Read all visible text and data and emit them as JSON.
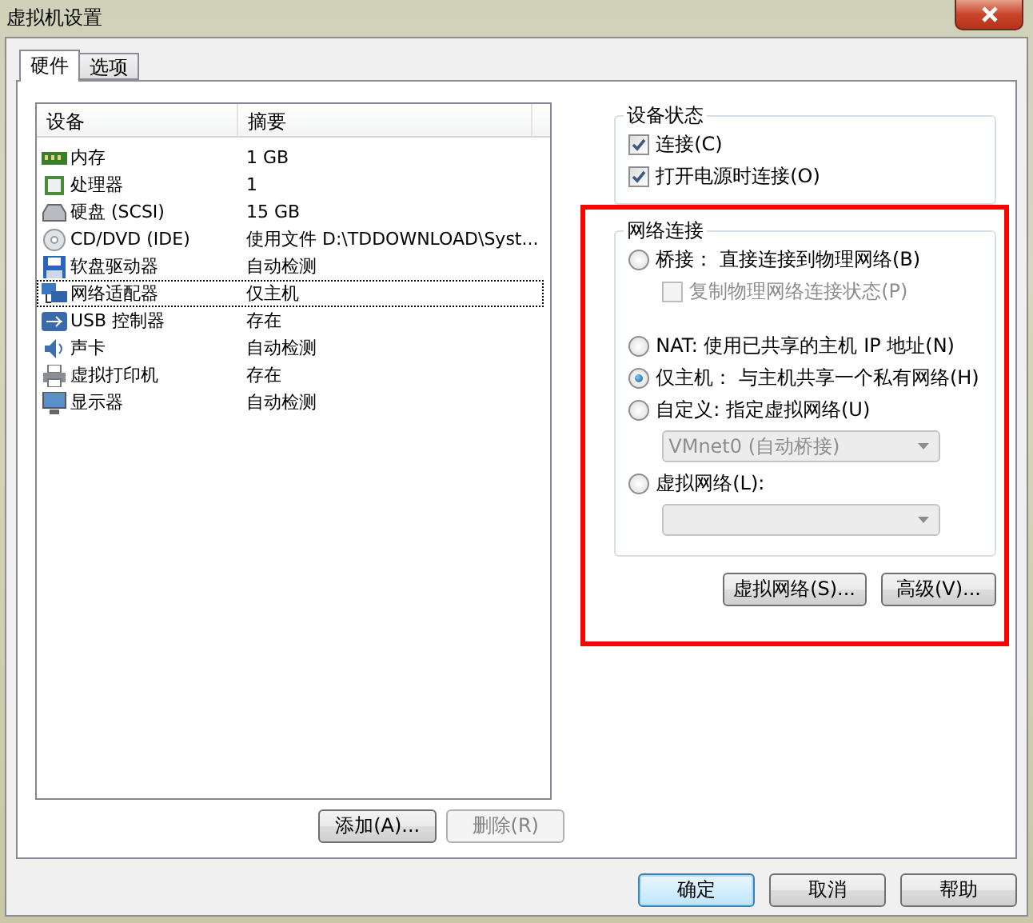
{
  "window": {
    "title": "虚拟机设置"
  },
  "tabs": [
    {
      "label": "硬件",
      "selected": true
    },
    {
      "label": "选项",
      "selected": false
    }
  ],
  "device_list": {
    "columns": [
      "设备",
      "摘要"
    ],
    "rows": [
      {
        "device": "内存",
        "summary": "1 GB",
        "selected": false
      },
      {
        "device": "处理器",
        "summary": "1",
        "selected": false
      },
      {
        "device": "硬盘 (SCSI)",
        "summary": "15 GB",
        "selected": false
      },
      {
        "device": "CD/DVD (IDE)",
        "summary": "使用文件 D:\\TDDOWNLOAD\\Syst...",
        "selected": false
      },
      {
        "device": "软盘驱动器",
        "summary": "自动检测",
        "selected": false
      },
      {
        "device": "网络适配器",
        "summary": "仅主机",
        "selected": true
      },
      {
        "device": "USB 控制器",
        "summary": "存在",
        "selected": false
      },
      {
        "device": "声卡",
        "summary": "自动检测",
        "selected": false
      },
      {
        "device": "虚拟打印机",
        "summary": "存在",
        "selected": false
      },
      {
        "device": "显示器",
        "summary": "自动检测",
        "selected": false
      }
    ]
  },
  "list_buttons": [
    {
      "label": "添加(A)...",
      "disabled": false
    },
    {
      "label": "删除(R)",
      "disabled": true
    }
  ],
  "device_status": {
    "title": "设备状态",
    "items": [
      {
        "label": "连接(C)",
        "checked": true
      },
      {
        "label": "打开电源时连接(O)",
        "checked": true
      }
    ]
  },
  "network_connection": {
    "title": "网络连接",
    "items": [
      {
        "kind": "radio",
        "label": "桥接： 直接连接到物理网络(B)",
        "selected": false
      },
      {
        "kind": "checkbox",
        "label": "复制物理网络连接状态(P)",
        "checked": false,
        "disabled": true
      },
      {
        "kind": "radio",
        "label": "NAT: 使用已共享的主机 IP 地址(N)",
        "selected": false
      },
      {
        "kind": "radio",
        "label": "仅主机： 与主机共享一个私有网络(H)",
        "selected": true
      },
      {
        "kind": "radio",
        "label": "自定义: 指定虚拟网络(U)",
        "selected": false
      },
      {
        "kind": "dropdown",
        "value": "VMnet0 (自动桥接)",
        "disabled": true
      },
      {
        "kind": "radio",
        "label": "虚拟网络(L):",
        "selected": false
      },
      {
        "kind": "dropdown",
        "disabled": true
      }
    ]
  },
  "network_buttons": [
    "虚拟网络(S)...",
    "高级(V)..."
  ],
  "dialog_buttons": [
    {
      "label": "确定",
      "default": true
    },
    {
      "label": "取消",
      "default": false
    },
    {
      "label": "帮助",
      "default": false
    }
  ]
}
